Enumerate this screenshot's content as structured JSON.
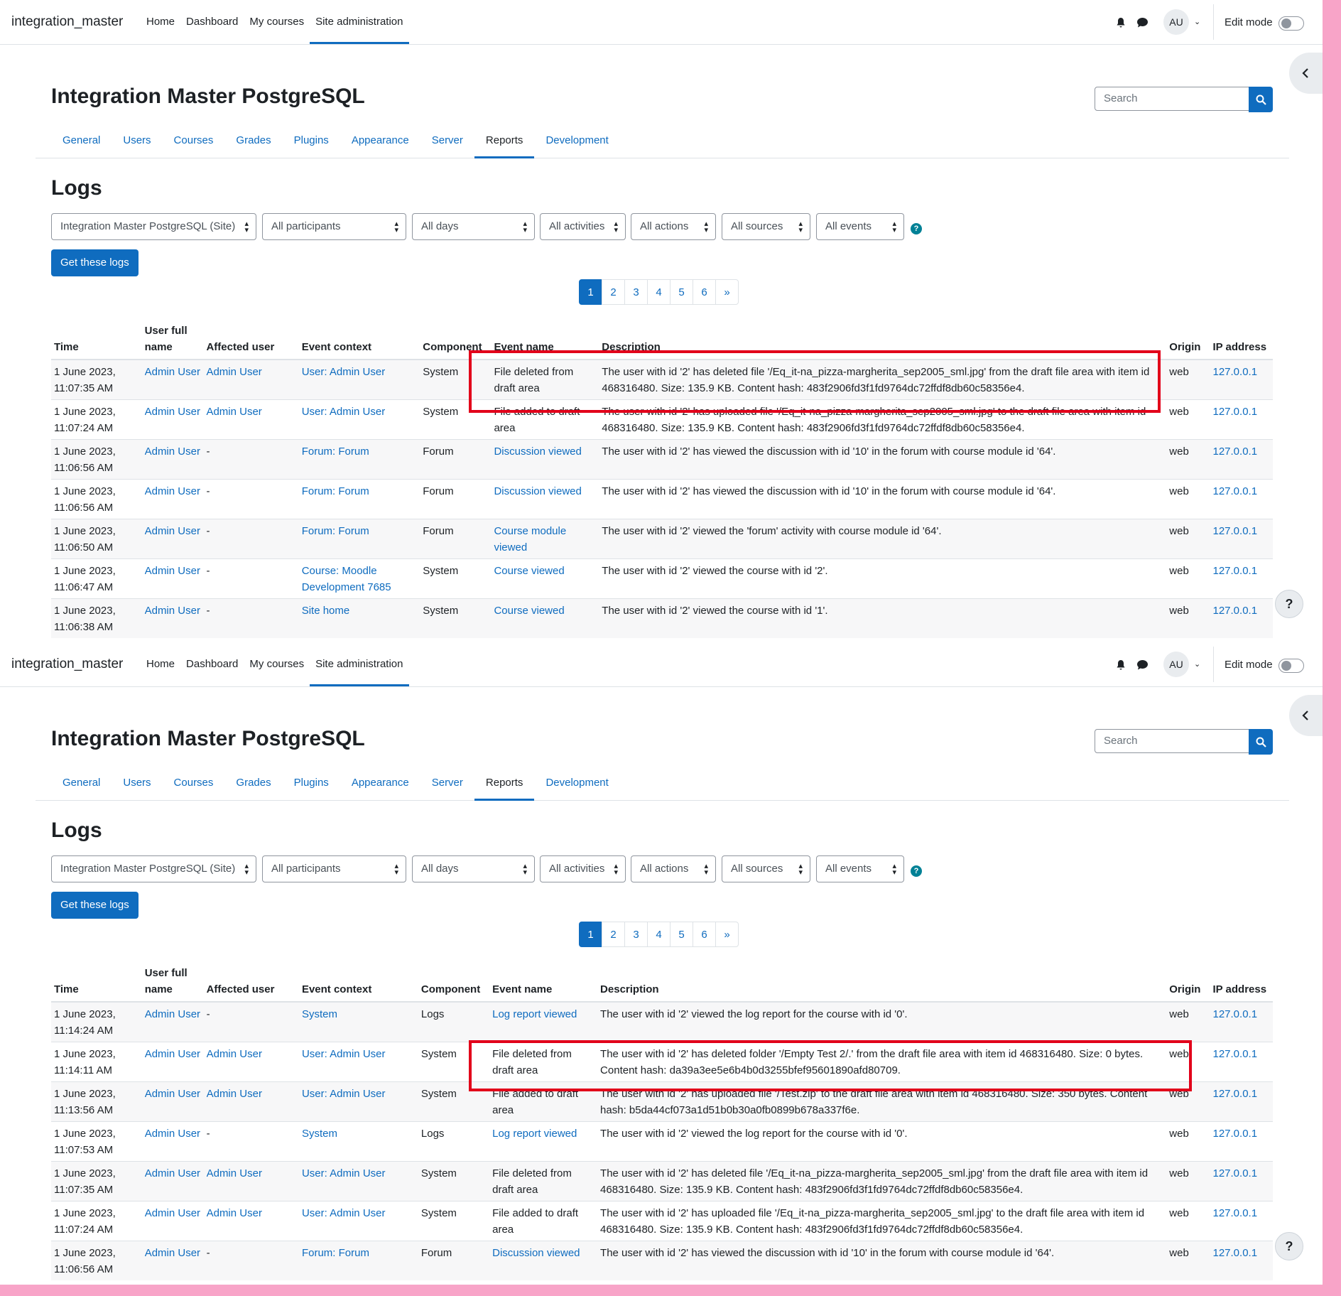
{
  "navbar": {
    "brand": "integration_master",
    "links": [
      "Home",
      "Dashboard",
      "My courses",
      "Site administration"
    ],
    "active_link": "Site administration",
    "avatar_initials": "AU",
    "edit_mode_label": "Edit mode",
    "edit_mode_on": false
  },
  "page": {
    "title": "Integration Master PostgreSQL",
    "search_placeholder": "Search",
    "tabs": [
      "General",
      "Users",
      "Courses",
      "Grades",
      "Plugins",
      "Appearance",
      "Server",
      "Reports",
      "Development"
    ],
    "active_tab": "Reports",
    "heading": "Logs"
  },
  "filters": {
    "course": "Integration Master PostgreSQL (Site)",
    "participants": "All participants",
    "days": "All days",
    "activities": "All activities",
    "actions": "All actions",
    "sources": "All sources",
    "events": "All events",
    "submit_label": "Get these logs"
  },
  "pagination": [
    "1",
    "2",
    "3",
    "4",
    "5",
    "6",
    "»"
  ],
  "table_headers": [
    "Time",
    "User full name",
    "Affected user",
    "Event context",
    "Component",
    "Event name",
    "Description",
    "Origin",
    "IP address"
  ],
  "panel1": {
    "rows": [
      {
        "time": "1 June 2023, 11:07:35 AM",
        "user": "Admin User",
        "affected": "Admin User",
        "context": "User: Admin User",
        "component": "System",
        "event": "File deleted from draft area",
        "description": "The user with id '2' has deleted file '/Eq_it-na_pizza-margherita_sep2005_sml.jpg' from the draft file area with item id 468316480. Size: 135.9 KB. Content hash: 483f2906fd3f1fd9764dc72ffdf8db60c58356e4.",
        "origin": "web",
        "ip": "127.0.0.1"
      },
      {
        "time": "1 June 2023, 11:07:24 AM",
        "user": "Admin User",
        "affected": "Admin User",
        "context": "User: Admin User",
        "component": "System",
        "event": "File added to draft area",
        "description": "The user with id '2' has uploaded file '/Eq_it-na_pizza-margherita_sep2005_sml.jpg' to the draft file area with item id 468316480. Size: 135.9 KB. Content hash: 483f2906fd3f1fd9764dc72ffdf8db60c58356e4.",
        "origin": "web",
        "ip": "127.0.0.1"
      },
      {
        "time": "1 June 2023, 11:06:56 AM",
        "user": "Admin User",
        "affected": "-",
        "context": "Forum: Forum",
        "component": "Forum",
        "event": "Discussion viewed",
        "description": "The user with id '2' has viewed the discussion with id '10' in the forum with course module id '64'.",
        "origin": "web",
        "ip": "127.0.0.1"
      },
      {
        "time": "1 June 2023, 11:06:56 AM",
        "user": "Admin User",
        "affected": "-",
        "context": "Forum: Forum",
        "component": "Forum",
        "event": "Discussion viewed",
        "description": "The user with id '2' has viewed the discussion with id '10' in the forum with course module id '64'.",
        "origin": "web",
        "ip": "127.0.0.1"
      },
      {
        "time": "1 June 2023, 11:06:50 AM",
        "user": "Admin User",
        "affected": "-",
        "context": "Forum: Forum",
        "component": "Forum",
        "event": "Course module viewed",
        "description": "The user with id '2' viewed the 'forum' activity with course module id '64'.",
        "origin": "web",
        "ip": "127.0.0.1"
      },
      {
        "time": "1 June 2023, 11:06:47 AM",
        "user": "Admin User",
        "affected": "-",
        "context": "Course: Moodle Development 7685",
        "component": "System",
        "event": "Course viewed",
        "description": "The user with id '2' viewed the course with id '2'.",
        "origin": "web",
        "ip": "127.0.0.1"
      },
      {
        "time": "1 June 2023, 11:06:38 AM",
        "user": "Admin User",
        "affected": "-",
        "context": "Site home",
        "component": "System",
        "event": "Course viewed",
        "description": "The user with id '2' viewed the course with id '1'.",
        "origin": "web",
        "ip": "127.0.0.1"
      }
    ]
  },
  "panel2": {
    "rows": [
      {
        "time": "1 June 2023, 11:14:24 AM",
        "user": "Admin User",
        "affected": "-",
        "context": "System",
        "component": "Logs",
        "event": "Log report viewed",
        "description": "The user with id '2' viewed the log report for the course with id '0'.",
        "origin": "web",
        "ip": "127.0.0.1"
      },
      {
        "time": "1 June 2023, 11:14:11 AM",
        "user": "Admin User",
        "affected": "Admin User",
        "context": "User: Admin User",
        "component": "System",
        "event": "File deleted from draft area",
        "description": "The user with id '2' has deleted folder '/Empty Test 2/.' from the draft file area with item id 468316480. Size: 0 bytes. Content hash: da39a3ee5e6b4b0d3255bfef95601890afd80709.",
        "origin": "web",
        "ip": "127.0.0.1"
      },
      {
        "time": "1 June 2023, 11:13:56 AM",
        "user": "Admin User",
        "affected": "Admin User",
        "context": "User: Admin User",
        "component": "System",
        "event": "File added to draft area",
        "description": "The user with id '2' has uploaded file '/Test.zip' to the draft file area with item id 468316480. Size: 350 bytes. Content hash: b5da44cf073a1d51b0b30a0fb0899b678a337f6e.",
        "origin": "web",
        "ip": "127.0.0.1"
      },
      {
        "time": "1 June 2023, 11:07:53 AM",
        "user": "Admin User",
        "affected": "-",
        "context": "System",
        "component": "Logs",
        "event": "Log report viewed",
        "description": "The user with id '2' viewed the log report for the course with id '0'.",
        "origin": "web",
        "ip": "127.0.0.1"
      },
      {
        "time": "1 June 2023, 11:07:35 AM",
        "user": "Admin User",
        "affected": "Admin User",
        "context": "User: Admin User",
        "component": "System",
        "event": "File deleted from draft area",
        "description": "The user with id '2' has deleted file '/Eq_it-na_pizza-margherita_sep2005_sml.jpg' from the draft file area with item id 468316480. Size: 135.9 KB. Content hash: 483f2906fd3f1fd9764dc72ffdf8db60c58356e4.",
        "origin": "web",
        "ip": "127.0.0.1"
      },
      {
        "time": "1 June 2023, 11:07:24 AM",
        "user": "Admin User",
        "affected": "Admin User",
        "context": "User: Admin User",
        "component": "System",
        "event": "File added to draft area",
        "description": "The user with id '2' has uploaded file '/Eq_it-na_pizza-margherita_sep2005_sml.jpg' to the draft file area with item id 468316480. Size: 135.9 KB. Content hash: 483f2906fd3f1fd9764dc72ffdf8db60c58356e4.",
        "origin": "web",
        "ip": "127.0.0.1"
      },
      {
        "time": "1 June 2023, 11:06:56 AM",
        "user": "Admin User",
        "affected": "-",
        "context": "Forum: Forum",
        "component": "Forum",
        "event": "Discussion viewed",
        "description": "The user with id '2' has viewed the discussion with id '10' in the forum with course module id '64'.",
        "origin": "web",
        "ip": "127.0.0.1"
      }
    ]
  },
  "icons": {
    "notifications": "bell-icon",
    "messages": "chat-bubble-icon",
    "search": "search-icon",
    "drawer_toggle": "chevron-left-icon",
    "help": "question-icon"
  },
  "colors": {
    "primary": "#0f6cbf",
    "highlight_box": "#e2001a",
    "frame": "#f8a4c8"
  }
}
